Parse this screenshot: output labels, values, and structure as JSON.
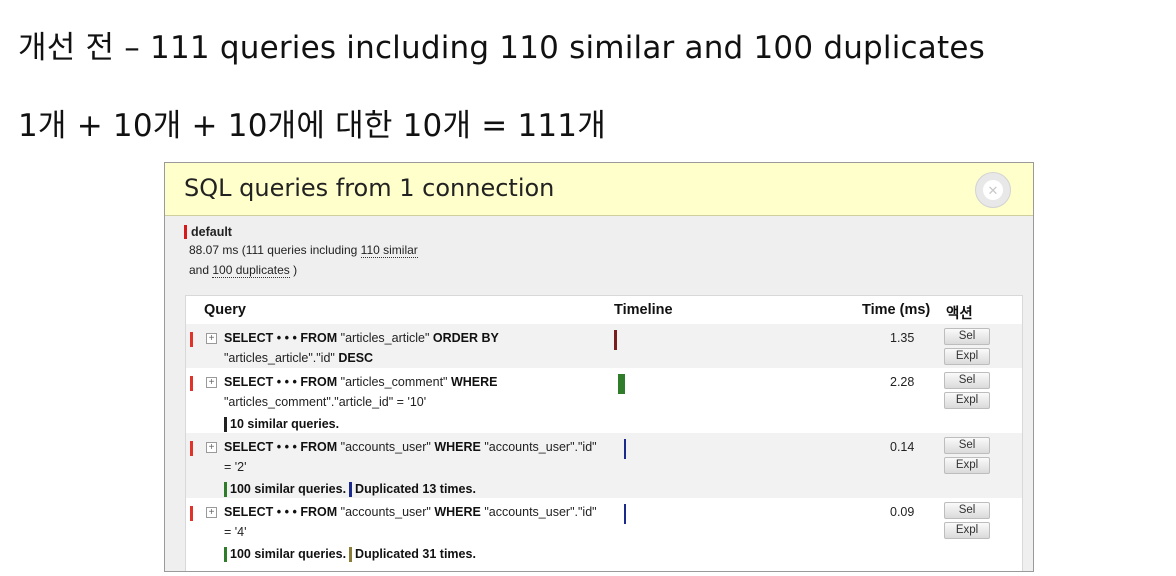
{
  "headings": {
    "line1": "개선 전 – 111 queries including 110 similar and 100 duplicates",
    "line2": "1개 + 10개 + 10개에 대한 10개 = 111개"
  },
  "panel": {
    "title": "SQL queries from 1 connection",
    "close_icon": "close-icon",
    "alias": "default",
    "summary_prefix": "88.07 ms (111 queries including",
    "similar_link": "110 similar",
    "summary_and": "and",
    "duplicates_link": "100 duplicates",
    "summary_suffix": ")"
  },
  "table": {
    "columns": {
      "query": "Query",
      "timeline": "Timeline",
      "time": "Time (ms)",
      "actions": "액션"
    },
    "sel_label": "Sel",
    "expl_label": "Expl",
    "expand_glyph": "+",
    "kw_select": "SELECT",
    "kw_dots": "• • •",
    "kw_from": "FROM",
    "rows": [
      {
        "table": "\"articles_article\"",
        "kw": "ORDER BY",
        "line2": "\"articles_article\".\"id\"",
        "line2_kw": "DESC",
        "time": "1.35"
      },
      {
        "table": "\"articles_comment\"",
        "kw": "WHERE",
        "line2": "\"articles_comment\".\"article_id\" = '10'",
        "similar": "10 similar queries.",
        "time": "2.28"
      },
      {
        "table": "\"accounts_user\"",
        "kw": "WHERE",
        "cond": "\"accounts_user\".\"id\"",
        "line2": "= '2'",
        "similar": "100 similar queries.",
        "duplicated": "Duplicated 13 times.",
        "time": "0.14"
      },
      {
        "table": "\"accounts_user\"",
        "kw": "WHERE",
        "cond": "\"accounts_user\".\"id\"",
        "line2": "= '4'",
        "similar": "100 similar queries.",
        "duplicated": "Duplicated 31 times.",
        "time": "0.09"
      }
    ]
  },
  "colors": {
    "header_bg": "#ffffcc",
    "connection_red": "#e0332b",
    "similar_dark_red": "#7b1d1d",
    "similar_green": "#2f7d2a",
    "duplicate_navy": "#1b2a8c",
    "duplicate_olive": "#8a7d3a"
  }
}
